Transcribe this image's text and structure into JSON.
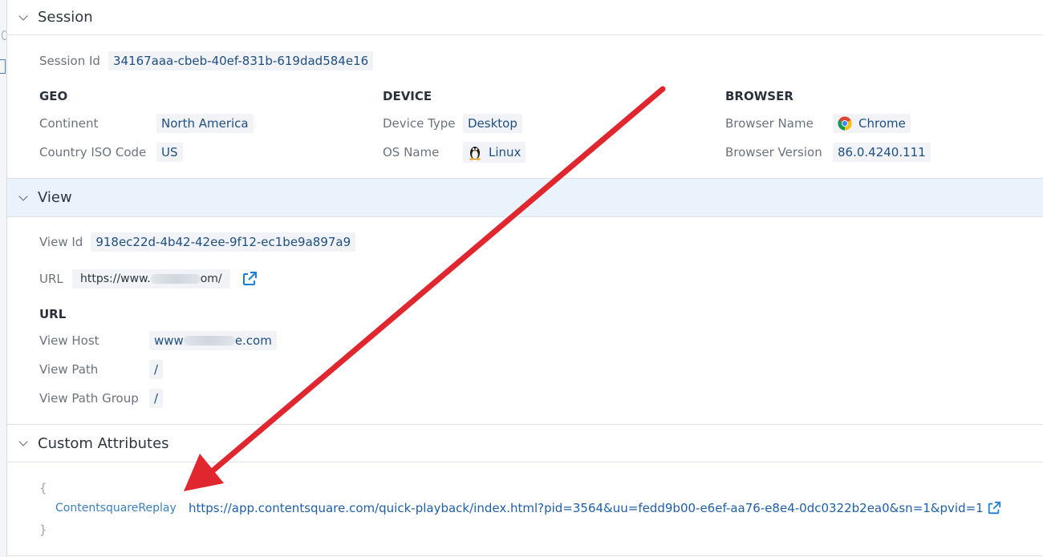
{
  "session": {
    "title": "Session",
    "session_id_label": "Session Id",
    "session_id": "34167aaa-cbeb-40ef-831b-619dad584e16",
    "geo": {
      "title": "GEO",
      "continent_label": "Continent",
      "continent": "North America",
      "country_label": "Country ISO Code",
      "country": "US"
    },
    "device": {
      "title": "DEVICE",
      "type_label": "Device Type",
      "type": "Desktop",
      "os_label": "OS Name",
      "os": "Linux",
      "os_icon": "linux-icon"
    },
    "browser": {
      "title": "BROWSER",
      "name_label": "Browser Name",
      "name": "Chrome",
      "name_icon": "chrome-icon",
      "version_label": "Browser Version",
      "version": "86.0.4240.111"
    }
  },
  "view": {
    "title": "View",
    "view_id_label": "View Id",
    "view_id": "918ec22d-4b42-42ee-9f12-ec1be9a897a9",
    "url_label": "URL",
    "url_prefix": "https://www.",
    "url_suffix": "om/",
    "url_group_title": "URL",
    "host_label": "View Host",
    "host_prefix": "www",
    "host_suffix": "e.com",
    "path_label": "View Path",
    "path": "/",
    "path_group_label": "View Path Group",
    "path_group": "/"
  },
  "custom": {
    "title": "Custom Attributes",
    "open_brace": "{",
    "close_brace": "}",
    "key": "ContentsquareReplay",
    "value": "https://app.contentsquare.com/quick-playback/index.html?pid=3564&uu=fedd9b00-e6ef-aa76-e8e4-0dc0322b2ea0&sn=1&pvid=1"
  },
  "colors": {
    "accent": "#1f5fa6",
    "annotation_arrow": "#e0262e",
    "active_header": "#eaf3fb"
  }
}
